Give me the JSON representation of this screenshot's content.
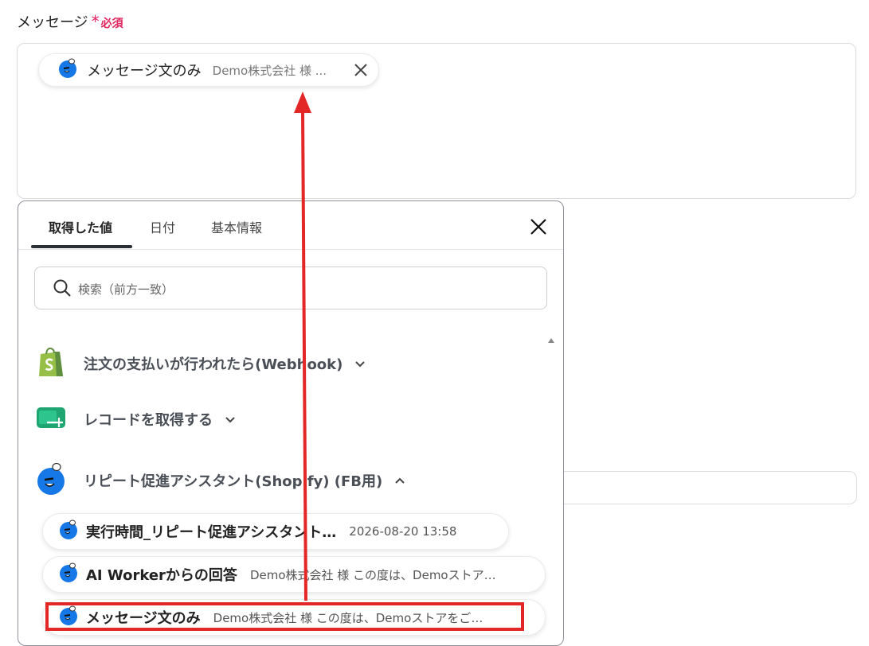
{
  "field": {
    "label": "メッセージ",
    "required_star": "*",
    "required_text": "必須"
  },
  "selected_chip": {
    "label": "メッセージ文のみ",
    "preview": "Demo株式会社 様 ...",
    "icon": "bot-icon"
  },
  "panel": {
    "tabs": [
      {
        "label": "取得した値",
        "active": true
      },
      {
        "label": "日付",
        "active": false
      },
      {
        "label": "基本情報",
        "active": false
      }
    ],
    "search_placeholder": "検索（前方一致）",
    "groups": [
      {
        "title": "注文の支払いが行われたら(Webhook)",
        "icon": "shopify-icon",
        "expanded": false
      },
      {
        "title": "レコードを取得する",
        "icon": "record-icon",
        "expanded": false
      },
      {
        "title": "リピート促進アシスタント(Shopify) (FB用)",
        "icon": "bot-icon",
        "expanded": true
      }
    ],
    "items": [
      {
        "label": "実行時間_リピート促進アシスタント…",
        "value": "2026-08-20 13:58"
      },
      {
        "label": "AI Workerからの回答",
        "value": "Demo株式会社 様 この度は、Demoストア…"
      },
      {
        "label": "メッセージ文のみ",
        "value": "Demo株式会社 様 この度は、Demoストアをご…"
      }
    ]
  },
  "colors": {
    "required": "#e0245e",
    "annotation": "#e32626",
    "bot_blue": "#1677e6",
    "shopify_green": "#95bf47"
  }
}
